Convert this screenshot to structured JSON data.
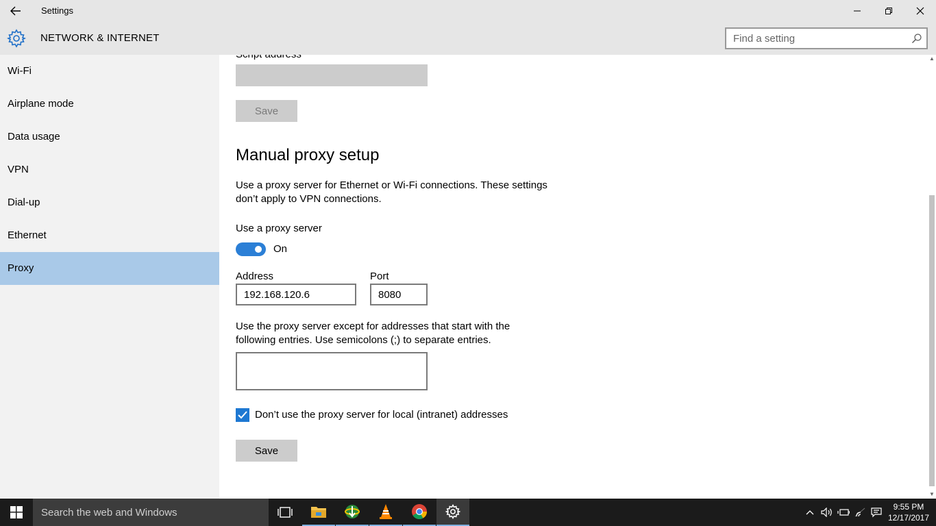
{
  "window": {
    "title": "Settings",
    "controls": [
      "minimize",
      "restore",
      "close"
    ]
  },
  "header": {
    "section_title": "NETWORK & INTERNET",
    "search_placeholder": "Find a setting"
  },
  "sidebar": {
    "items": [
      {
        "label": "Wi-Fi",
        "selected": false
      },
      {
        "label": "Airplane mode",
        "selected": false
      },
      {
        "label": "Data usage",
        "selected": false
      },
      {
        "label": "VPN",
        "selected": false
      },
      {
        "label": "Dial-up",
        "selected": false
      },
      {
        "label": "Ethernet",
        "selected": false
      },
      {
        "label": "Proxy",
        "selected": true
      }
    ]
  },
  "main": {
    "script_address_label": "Script address",
    "script_address_value": "",
    "script_save_label": "Save",
    "manual_heading": "Manual proxy setup",
    "manual_description": "Use a proxy server for Ethernet or Wi-Fi connections. These settings don’t apply to VPN connections.",
    "use_proxy_label": "Use a proxy server",
    "use_proxy_state": "On",
    "address_label": "Address",
    "address_value": "192.168.120.6",
    "port_label": "Port",
    "port_value": "8080",
    "exceptions_description": "Use the proxy server except for addresses that start with the following entries. Use semicolons (;) to separate entries.",
    "exceptions_value": "",
    "local_checkbox_label": "Don’t use the proxy server for local (intranet) addresses",
    "local_checkbox_checked": true,
    "save_label": "Save"
  },
  "taskbar": {
    "search_placeholder": "Search the web and Windows",
    "apps": [
      "task-view",
      "file-explorer",
      "internet-download-manager",
      "vlc",
      "chrome",
      "settings"
    ],
    "time": "9:55 PM",
    "date": "12/17/2017"
  },
  "colors": {
    "accent": "#2b7fd6",
    "selected_nav": "#a9c9e8",
    "chrome_bg": "#e6e6e6",
    "sidebar_bg": "#f2f2f2",
    "taskbar_bg": "#1b1b1b"
  }
}
